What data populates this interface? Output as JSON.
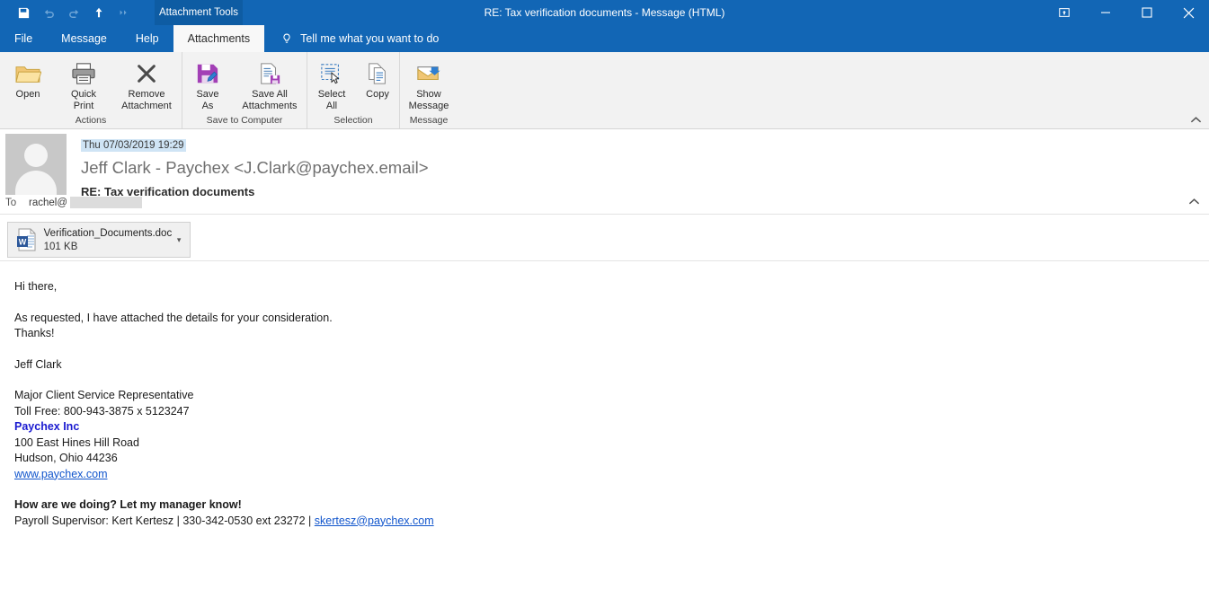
{
  "window": {
    "title": "RE: Tax verification documents  -  Message (HTML)",
    "contextual_tab": "Attachment Tools"
  },
  "quick_access": [
    {
      "name": "save-icon",
      "label": "Save"
    },
    {
      "name": "undo-icon",
      "label": "Undo"
    },
    {
      "name": "redo-icon",
      "label": "Redo"
    },
    {
      "name": "up-arrow-icon",
      "label": "Previous Item"
    },
    {
      "name": "chevron-double-right-icon",
      "label": "Customize Quick Access Toolbar"
    }
  ],
  "window_controls": [
    {
      "name": "ribbon-display-options-icon",
      "label": "Ribbon Display Options"
    },
    {
      "name": "minimize-icon",
      "label": "Minimize"
    },
    {
      "name": "maximize-icon",
      "label": "Maximize"
    },
    {
      "name": "close-icon",
      "label": "Close"
    }
  ],
  "tabs": [
    {
      "label": "File",
      "active": false
    },
    {
      "label": "Message",
      "active": false
    },
    {
      "label": "Help",
      "active": false
    },
    {
      "label": "Attachments",
      "active": true
    }
  ],
  "tell_me": {
    "placeholder": "Tell me what you want to do",
    "icon": "lightbulb-icon"
  },
  "ribbon": {
    "groups": [
      {
        "label": "Actions",
        "buttons": [
          {
            "label": "Open",
            "icon": "open-folder-icon"
          },
          {
            "label": "Quick\nPrint",
            "line1": "Quick",
            "line2": "Print",
            "icon": "printer-icon"
          },
          {
            "label": "Remove\nAttachment",
            "line1": "Remove",
            "line2": "Attachment",
            "icon": "remove-x-icon"
          }
        ]
      },
      {
        "label": "Save to Computer",
        "buttons": [
          {
            "line1": "Save",
            "line2": "As",
            "icon": "save-as-icon"
          },
          {
            "line1": "Save All",
            "line2": "Attachments",
            "icon": "save-all-attachments-icon"
          }
        ]
      },
      {
        "label": "Selection",
        "buttons": [
          {
            "line1": "Select",
            "line2": "All",
            "icon": "select-all-icon"
          },
          {
            "line1": "Copy",
            "line2": "",
            "icon": "copy-icon"
          }
        ]
      },
      {
        "label": "Message",
        "buttons": [
          {
            "line1": "Show",
            "line2": "Message",
            "icon": "show-message-icon"
          }
        ]
      }
    ],
    "collapse_icon": "chevron-up-icon"
  },
  "message": {
    "date": "Thu 07/03/2019 19:29",
    "from": "Jeff Clark - Paychex <J.Clark@paychex.email>",
    "subject": "RE: Tax verification documents",
    "to_label": "To",
    "to_value": "rachel@",
    "collapse_icon": "chevron-up-icon"
  },
  "attachment": {
    "file_name": "Verification_Documents.doc",
    "file_size": "101 KB",
    "icon": "word-document-icon",
    "caret": "▾"
  },
  "body": {
    "greeting": "Hi there,",
    "line1": "As requested, I have attached the details for your consideration.",
    "line2": "Thanks!",
    "sign_off": "Jeff Clark",
    "title": "Major Client Service Representative",
    "phone": "Toll Free: 800-943-3875 x 5123247",
    "company": "Paychex Inc",
    "address1": "100 East Hines Hill Road",
    "address2": "Hudson, Ohio 44236",
    "website": "www.paychex.com",
    "feedback_heading": "How are we doing? Let my manager know!",
    "supervisor_prefix": "Payroll Supervisor:  Kert Kertesz | 330-342-0530 ext 23272 | ",
    "supervisor_email": "skertesz@paychex.com"
  },
  "colors": {
    "titlebar": "#1266b5",
    "contextual_tab": "#0e5ca3",
    "ribbon_bg": "#f2f2f2",
    "date_highlight": "#cfe4f5",
    "link": "#1155cc",
    "company_blue": "#1a1ad0"
  }
}
